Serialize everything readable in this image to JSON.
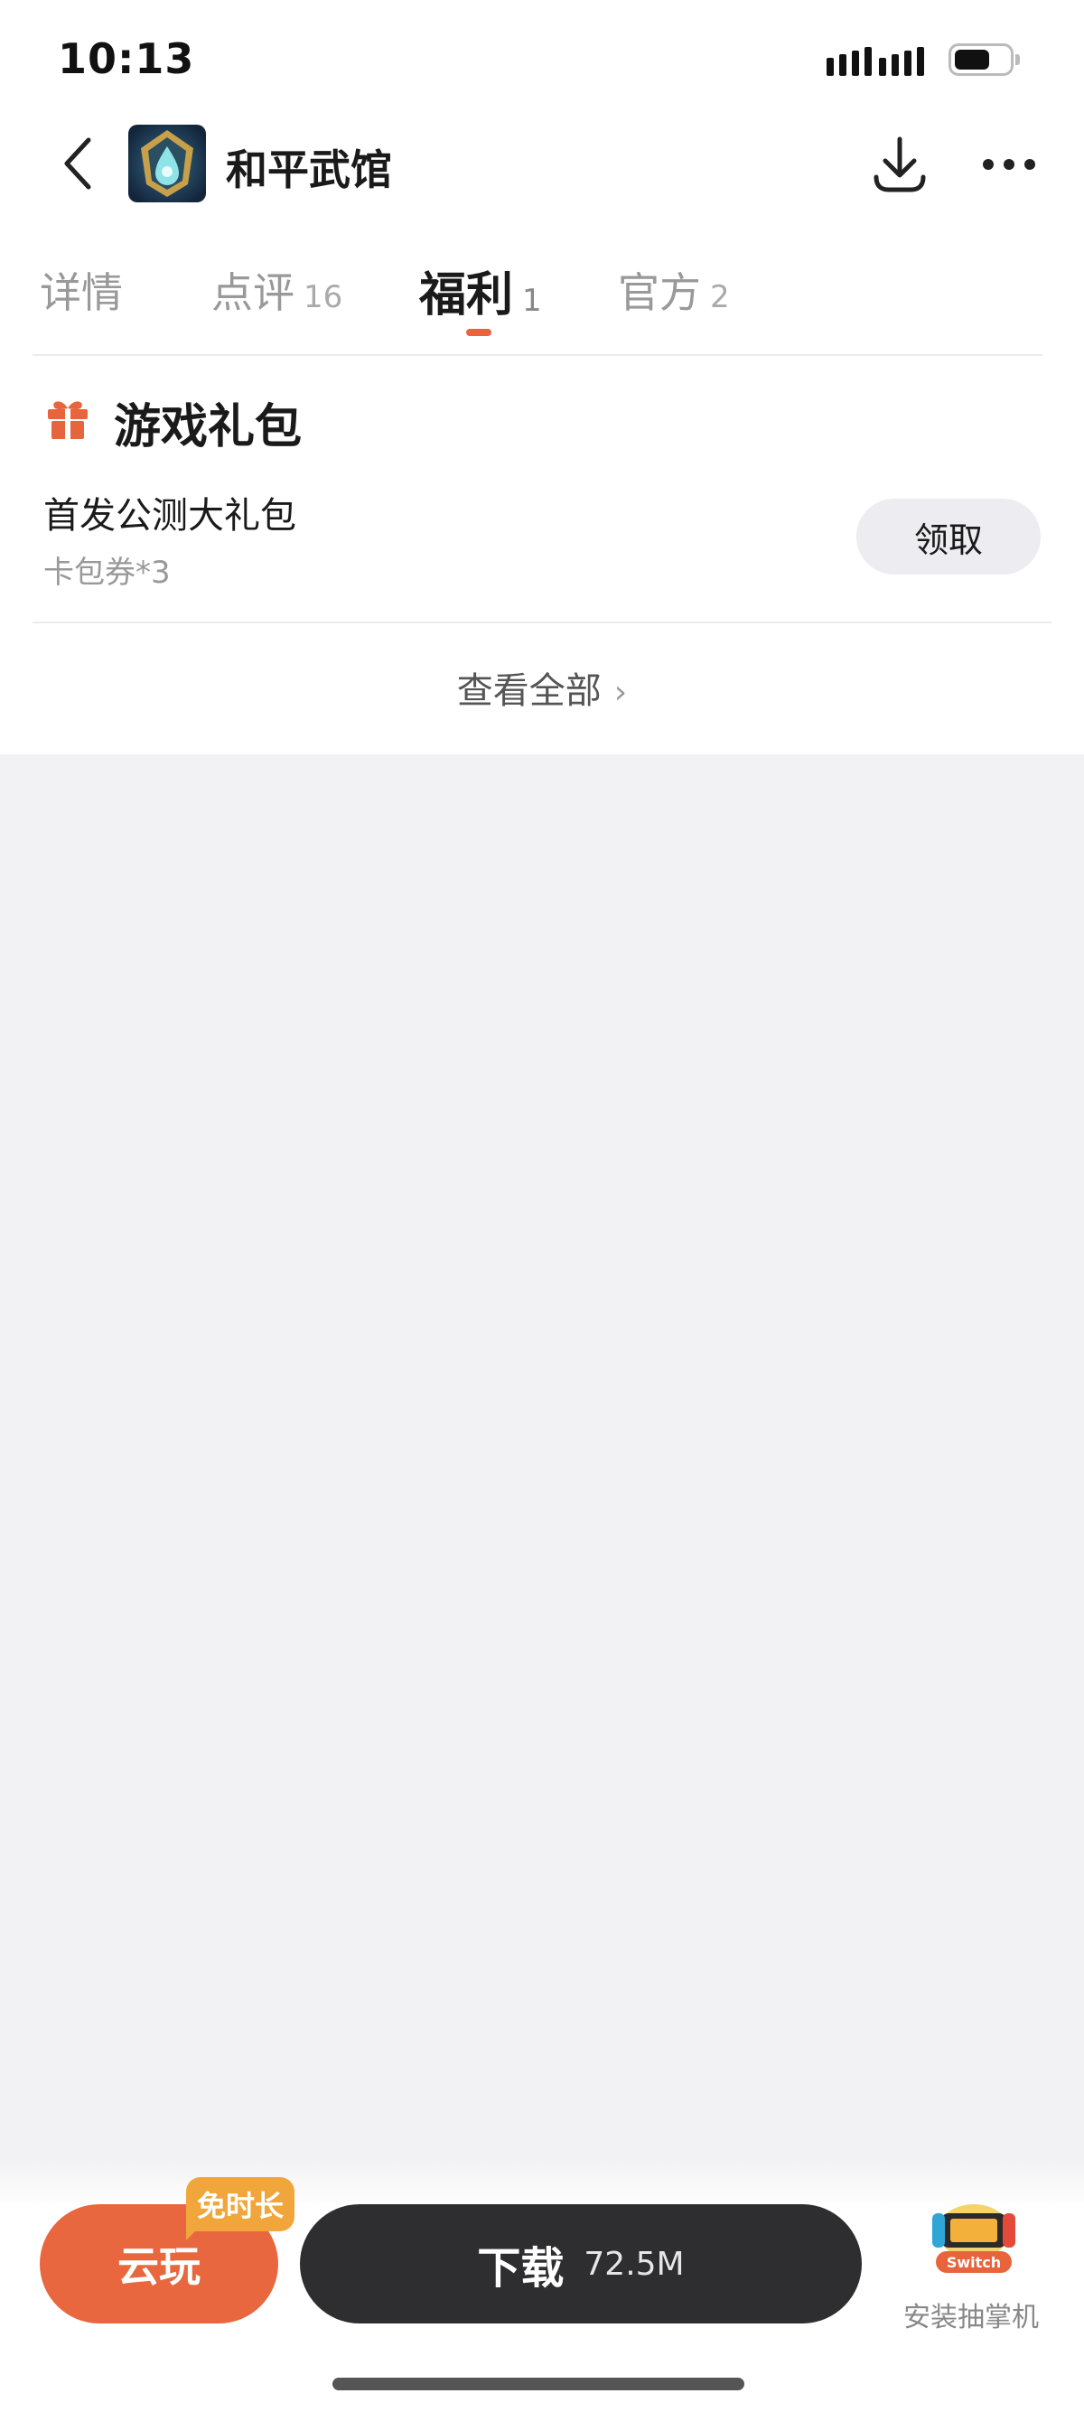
{
  "status_bar": {
    "time": "10:13"
  },
  "header": {
    "title": "和平武馆",
    "back_icon": "chevron-left-icon",
    "download_icon": "download-icon",
    "more_icon": "more-dots-icon"
  },
  "tabs": [
    {
      "label": "详情",
      "count": ""
    },
    {
      "label": "点评",
      "count": "16"
    },
    {
      "label": "福利",
      "count": "1",
      "active": true
    },
    {
      "label": "官方",
      "count": "2"
    }
  ],
  "gift_section": {
    "title": "游戏礼包",
    "icon": "gift-icon",
    "items": [
      {
        "name": "首发公测大礼包",
        "desc": "卡包券*3",
        "action": "领取"
      }
    ],
    "view_all": "查看全部"
  },
  "bottom_bar": {
    "cloud_play": "云玩",
    "cloud_badge": "免时长",
    "download_label": "下载",
    "download_size": "72.5M",
    "promo_label": "安装抽掌机",
    "promo_badge": "Switch"
  },
  "colors": {
    "accent": "#e8643c",
    "badge": "#f0a63a",
    "download_button": "#2e2e30",
    "page_bg": "#f2f2f4"
  }
}
